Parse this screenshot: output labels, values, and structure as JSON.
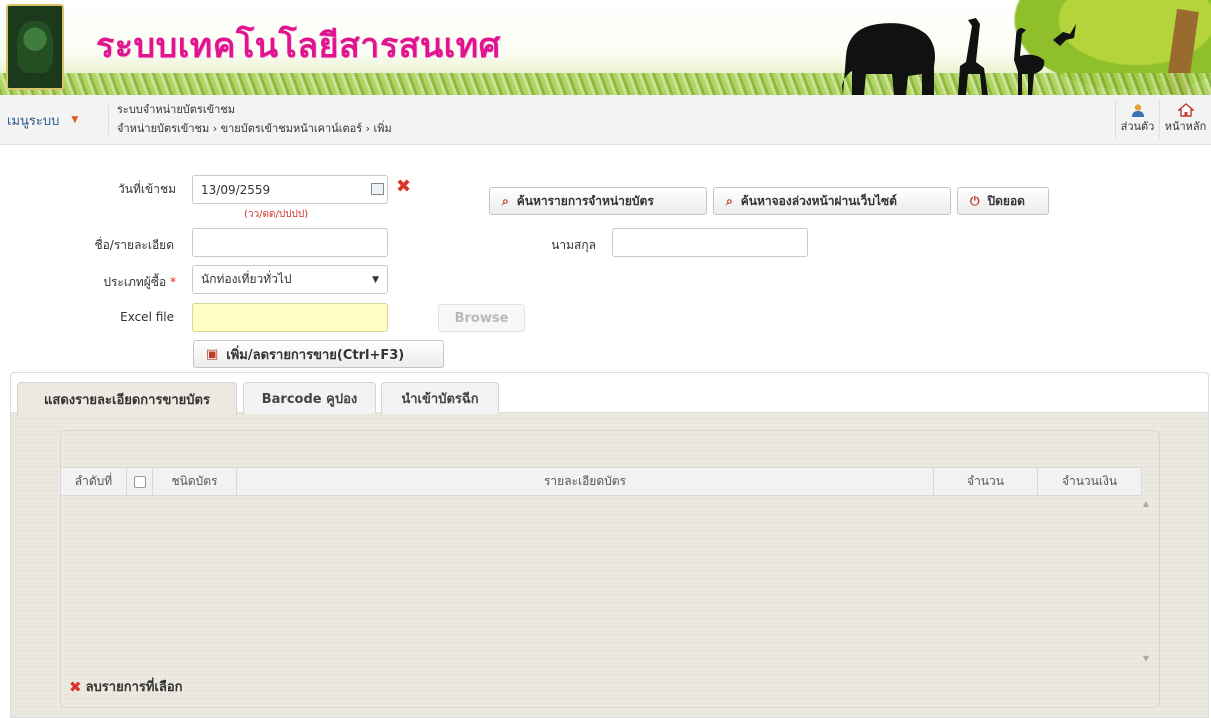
{
  "header": {
    "title": "ระบบเทคโนโลยีสารสนเทศ",
    "logo_icon": "chiang-mai-night-safari-logo"
  },
  "menubar": {
    "system_menu_label": "เมนูระบบ",
    "breadcrumb_title": "ระบบจำหน่ายบัตรเข้าชม",
    "breadcrumb_path": "จำหน่ายบัตรเข้าชม › ขายบัตรเข้าชมหน้าเคาน์เตอร์ › เพิ่ม",
    "profile_label": "ส่วนตัว",
    "home_label": "หน้าหลัก"
  },
  "form": {
    "visit_date_label": "วันที่เข้าชม",
    "visit_date_value": "13/09/2559",
    "date_format_hint": "(วว/ดด/ปปปป)",
    "name_label": "ชื่อ/รายละเอียด",
    "name_value": "",
    "surname_label": "นามสกุล",
    "surname_value": "",
    "buyer_type_label": "ประเภทผู้ซื้อ",
    "buyer_type_required": "*",
    "buyer_type_value": "นักท่องเที่ยวทั่วไป",
    "excel_label": "Excel file",
    "excel_value": "",
    "browse_label": "Browse",
    "add_button_label": "เพิ่ม/ลดรายการขาย(Ctrl+F3)",
    "search_sales_label": "ค้นหารายการจำหน่ายบัตร",
    "search_web_booking_label": "ค้นหาจองล่วงหน้าผ่านเว็บไซต์",
    "close_balance_label": "ปิดยอด"
  },
  "tabs": [
    {
      "label": "แสดงรายละเอียดการขายบัตร",
      "active": true
    },
    {
      "label": "Barcode คูปอง",
      "active": false
    },
    {
      "label": "นำเข้าบัตรฉีก",
      "active": false
    }
  ],
  "grid": {
    "columns": [
      "ลำดับที่",
      "",
      "ชนิดบัตร",
      "รายละเอียดบัตร",
      "จำนวน",
      "จำนวนเงิน"
    ],
    "rows": [],
    "delete_selected_label": "ลบรายการที่เลือก"
  },
  "colors": {
    "title_pink": "#e0148f",
    "link_blue": "#2b5b8c",
    "danger_red": "#d9342b",
    "highlight_yellow": "#ffffc4"
  }
}
